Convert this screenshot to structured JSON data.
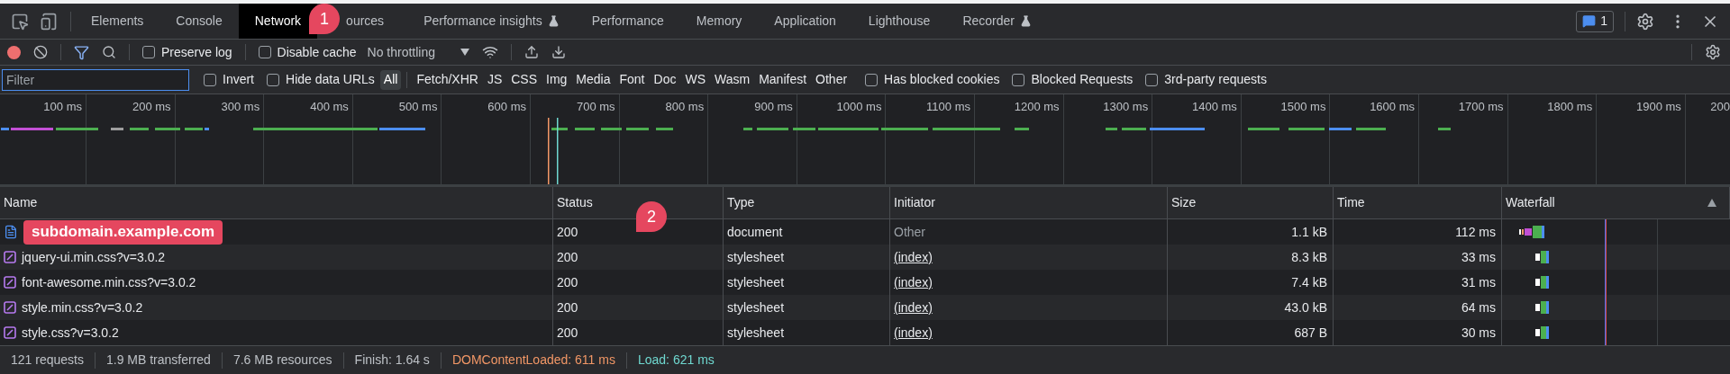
{
  "tabs": [
    {
      "label": "Elements",
      "selected": false,
      "experimental": false
    },
    {
      "label": "Console",
      "selected": false,
      "experimental": false
    },
    {
      "label": "Network",
      "selected": true,
      "experimental": false
    },
    {
      "label": "ources",
      "selected": false,
      "experimental": false
    },
    {
      "label": "Performance insights",
      "selected": false,
      "experimental": true
    },
    {
      "label": "Performance",
      "selected": false,
      "experimental": false
    },
    {
      "label": "Memory",
      "selected": false,
      "experimental": false
    },
    {
      "label": "Application",
      "selected": false,
      "experimental": false
    },
    {
      "label": "Lighthouse",
      "selected": false,
      "experimental": false
    },
    {
      "label": "Recorder",
      "selected": false,
      "experimental": true
    }
  ],
  "issues_count": "1",
  "callouts": [
    {
      "text": "1"
    },
    {
      "text": "2"
    }
  ],
  "toolbar": {
    "recording": true,
    "filter_active": true,
    "options": [
      {
        "label": "Preserve log",
        "checked": false
      },
      {
        "label": "Disable cache",
        "checked": false
      }
    ],
    "throttling": "No throttling"
  },
  "filter": {
    "placeholder": "Filter",
    "options": [
      {
        "label": "Invert",
        "checked": false
      },
      {
        "label": "Hide data URLs",
        "checked": false
      }
    ],
    "types": [
      {
        "label": "All",
        "selected": true
      },
      {
        "label": "Fetch/XHR",
        "selected": false
      },
      {
        "label": "JS",
        "selected": false
      },
      {
        "label": "CSS",
        "selected": false
      },
      {
        "label": "Img",
        "selected": false
      },
      {
        "label": "Media",
        "selected": false
      },
      {
        "label": "Font",
        "selected": false
      },
      {
        "label": "Doc",
        "selected": false
      },
      {
        "label": "WS",
        "selected": false
      },
      {
        "label": "Wasm",
        "selected": false
      },
      {
        "label": "Manifest",
        "selected": false
      },
      {
        "label": "Other",
        "selected": false
      }
    ],
    "extra": [
      {
        "label": "Has blocked cookies",
        "checked": false
      },
      {
        "label": "Blocked Requests",
        "checked": false
      },
      {
        "label": "3rd-party requests",
        "checked": false
      }
    ]
  },
  "overview": {
    "ticks": [
      "100 ms",
      "200 ms",
      "300 ms",
      "400 ms",
      "500 ms",
      "600 ms",
      "700 ms",
      "800 ms",
      "900 ms",
      "1000 ms",
      "1100 ms",
      "1200 ms",
      "1300 ms",
      "1400 ms",
      "1500 ms",
      "1600 ms",
      "1700 ms",
      "1800 ms",
      "1900 ms",
      "200"
    ]
  },
  "table": {
    "columns": [
      "Name",
      "Status",
      "Type",
      "Initiator",
      "Size",
      "Time",
      "Waterfall"
    ],
    "rows": [
      {
        "kind": "document",
        "name": "subdomain.example.com",
        "masked": true,
        "status": "200",
        "type": "document",
        "initiator": "Other",
        "initiator_link": false,
        "size": "1.1 kB",
        "time": "112 ms"
      },
      {
        "kind": "stylesheet",
        "name": "jquery-ui.min.css?v=3.0.2",
        "masked": false,
        "status": "200",
        "type": "stylesheet",
        "initiator": "(index)",
        "initiator_link": true,
        "size": "8.3 kB",
        "time": "33 ms"
      },
      {
        "kind": "stylesheet",
        "name": "font-awesome.min.css?v=3.0.2",
        "masked": false,
        "status": "200",
        "type": "stylesheet",
        "initiator": "(index)",
        "initiator_link": true,
        "size": "7.4 kB",
        "time": "31 ms"
      },
      {
        "kind": "stylesheet",
        "name": "style.min.css?v=3.0.2",
        "masked": false,
        "status": "200",
        "type": "stylesheet",
        "initiator": "(index)",
        "initiator_link": true,
        "size": "43.0 kB",
        "time": "64 ms"
      },
      {
        "kind": "stylesheet",
        "name": "style.css?v=3.0.2",
        "masked": false,
        "status": "200",
        "type": "stylesheet",
        "initiator": "(index)",
        "initiator_link": true,
        "size": "687 B",
        "time": "30 ms"
      }
    ]
  },
  "status_bar": [
    {
      "text": "121 requests",
      "color": "#bdc1c6"
    },
    {
      "text": "1.9 MB transferred",
      "color": "#bdc1c6"
    },
    {
      "text": "7.6 MB resources",
      "color": "#bdc1c6"
    },
    {
      "text": "Finish: 1.64 s",
      "color": "#bdc1c6"
    },
    {
      "text": "DOMContentLoaded: 611 ms",
      "color": "#f29766"
    },
    {
      "text": "Load: 621 ms",
      "color": "#6fd8d0"
    }
  ]
}
